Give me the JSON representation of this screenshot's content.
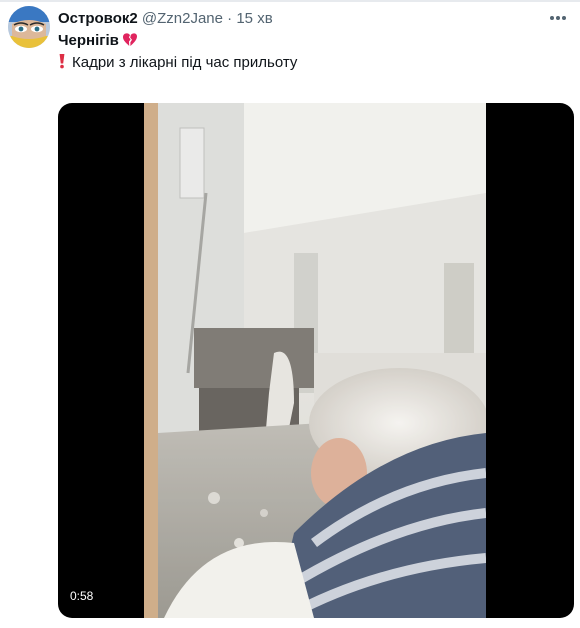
{
  "tweet": {
    "author_name": "Островок2",
    "handle": "@Zzn2Jane",
    "separator": "·",
    "time": "15 хв",
    "more_icon": "ellipsis-icon",
    "heading": "Чернігів",
    "heading_emoji": "broken-heart-icon",
    "body_emoji": "red-exclamation-icon",
    "body_text": "Кадри з лікарні під час прильоту"
  },
  "video": {
    "duration": "0:58",
    "background_color": "#000000"
  },
  "colors": {
    "text": "#0f1419",
    "secondary": "#536471",
    "divider": "#e7eaee",
    "heart": "#e0245e",
    "exclamation": "#dd2e44"
  }
}
